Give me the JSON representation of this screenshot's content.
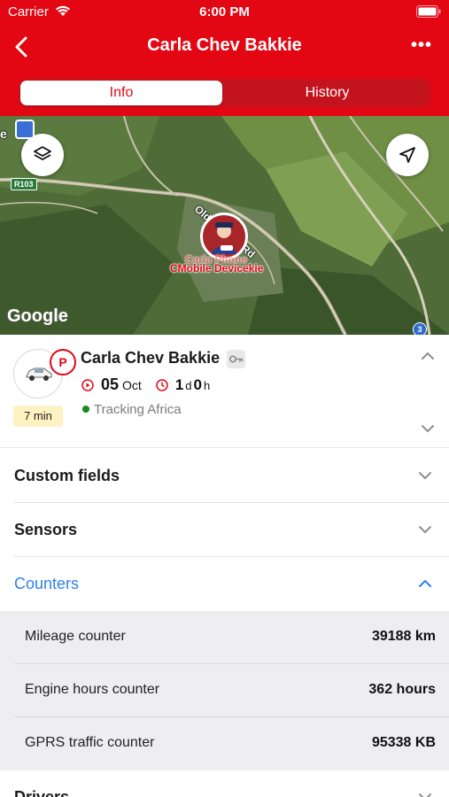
{
  "status_bar": {
    "carrier": "Carrier",
    "time": "6:00 PM"
  },
  "nav": {
    "title": "Carla Chev Bakkie",
    "more_label": "•••"
  },
  "tabs": [
    {
      "label": "Info",
      "active": true
    },
    {
      "label": "History",
      "active": false
    }
  ],
  "map": {
    "road_label": "Old Howick Rd",
    "route_shield": "R103",
    "route_shield_2": "3",
    "poi_label": "e",
    "marker_label": "CMobile Devicekie",
    "marker_label_ghost": "Carla Phone",
    "attribution": "Google"
  },
  "unit": {
    "name": "Carla Chev Bakkie",
    "status_badge": "P",
    "time_since": "7 min",
    "date_day": "05",
    "date_month": "Oct",
    "duration_days": "1",
    "duration_days_unit": "d",
    "duration_hours": "0",
    "duration_hours_unit": "h",
    "tracking": "Tracking Africa"
  },
  "sections": [
    {
      "label": "Custom fields",
      "expanded": false
    },
    {
      "label": "Sensors",
      "expanded": false
    },
    {
      "label": "Counters",
      "expanded": true
    }
  ],
  "counters": [
    {
      "name": "Mileage counter",
      "value": "39188 km"
    },
    {
      "name": "Engine hours counter",
      "value": "362 hours"
    },
    {
      "name": "GPRS traffic counter",
      "value": "95338 KB"
    }
  ],
  "drivers": {
    "label": "Drivers"
  },
  "colors": {
    "brand_red": "#e30613",
    "link_blue": "#2f80ed",
    "online_green": "#1a8a1a",
    "chip_yellow": "#fdf2c2"
  }
}
